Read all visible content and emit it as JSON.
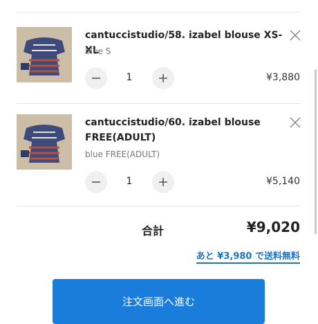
{
  "cart": {
    "items": [
      {
        "title": "cantuccistudio/58. izabel blouse XS-XL",
        "variant": "blue S",
        "quantity": "1",
        "price": "¥3,880",
        "thumbnail_icon": "blouse-photo"
      },
      {
        "title": "cantuccistudio/60. izabel blouse FREE(ADULT)",
        "variant": "blue FREE(ADULT)",
        "quantity": "1",
        "price": "¥5,140",
        "thumbnail_icon": "blouse-photo"
      }
    ],
    "total_label": "合計",
    "total_value": "¥9,020",
    "free_shipping_note": "あと ¥3,980 で送料無料",
    "checkout_label": "注文画面へ進む"
  },
  "icons": {
    "remove": "close-icon",
    "decrement": "minus-icon",
    "increment": "plus-icon"
  },
  "colors": {
    "accent": "#1a7ddb",
    "link": "#1a73c8"
  }
}
